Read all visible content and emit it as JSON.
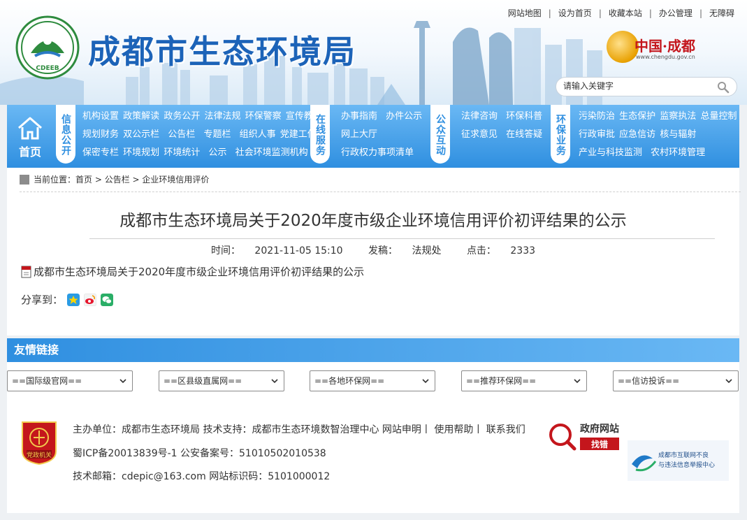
{
  "topnav": [
    "网站地图",
    "设为首页",
    "收藏本站",
    "办公管理",
    "无障碍"
  ],
  "header": {
    "site_title": "成都市生态环境局",
    "logo_text": "CDEEB",
    "city_badge": "中国·成都",
    "city_url": "www.chengdu.gov.cn",
    "search_placeholder": "请输入关键字"
  },
  "nav": {
    "home": "首页",
    "groups": [
      {
        "tag": "信息公开",
        "rows": [
          [
            "机构设置",
            "政策解读",
            "政务公开",
            "法律法规",
            "环保警察",
            "宣传教育"
          ],
          [
            "规划财务",
            "双公示栏",
            "公告栏",
            "专题栏",
            "组织人事",
            "党建工作"
          ],
          [
            "保密专栏",
            "环境规划",
            "环境统计",
            "公示",
            "社会环境监测机构"
          ]
        ]
      },
      {
        "tag": "在线服务",
        "rows": [
          [
            "办事指南",
            "办件公示"
          ],
          [
            "网上大厅"
          ],
          [
            "行政权力事项清单"
          ]
        ]
      },
      {
        "tag": "公众互动",
        "rows": [
          [
            "法律咨询",
            "环保科普"
          ],
          [
            "征求意见",
            "在线答疑"
          ]
        ]
      },
      {
        "tag": "环保业务",
        "rows": [
          [
            "污染防治",
            "生态保护",
            "监察执法",
            "总量控制"
          ],
          [
            "行政审批",
            "应急信访",
            "核与辐射"
          ],
          [
            "产业与科技监测",
            "农村环境管理"
          ]
        ]
      }
    ]
  },
  "breadcrumb": {
    "label": "当前位置：",
    "items": [
      "首页",
      "公告栏",
      "企业环境信用评价"
    ]
  },
  "article": {
    "title": "成都市生态环境局关于2020年度市级企业环境信用评价初评结果的公示",
    "time_label": "时间：",
    "time": "2021-11-05 15:10",
    "source_label": "发稿：",
    "source": "法规处",
    "clicks_label": "点击：",
    "clicks": "2333",
    "attachment": "成都市生态环境局关于2020年度市级企业环境信用评价初评结果的公示",
    "share_label": "分享到："
  },
  "friend_links": {
    "title": "友情链接",
    "selects": [
      "==国际级官网==",
      "==区县级直属网==",
      "==各地环保网==",
      "==推荐环保网==",
      "==信访投诉=="
    ]
  },
  "footer": {
    "line1": "主办单位：成都市生态环境局 技术支持：成都市生态环境数智治理中心 网站申明丨 使用帮助丨 联系我们",
    "line2": "蜀ICP备20013839号-1     公安备案号：51010502010538",
    "line3": "技术邮箱：cdepic@163.com 网站标识码：5101000012",
    "party_badge": "党政机关",
    "gov_find_title": "政府网站",
    "gov_find_sub": "找错",
    "report_line1": "成都市互联网不良",
    "report_line2": "与违法信息举报中心"
  },
  "colors": {
    "brand_blue": "#1c63b8",
    "nav_blue": "#2f8fe0",
    "nav_light": "#6ab8f4",
    "badge_red": "#c4161c"
  }
}
